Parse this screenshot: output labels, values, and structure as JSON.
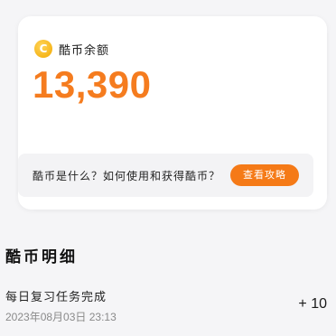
{
  "balance": {
    "icon": "coin-icon",
    "icon_glyph": "C",
    "label": "酷币余额",
    "amount": "13,390",
    "accent_color": "#f57c1f"
  },
  "help": {
    "question": "酷币是什么？如何使用和获得酷币？",
    "button_label": "查看攻略",
    "button_color": "#f57a17"
  },
  "details": {
    "title": "酷币明细",
    "items": [
      {
        "title": "每日复习任务完成",
        "time": "2023年08月03日 23:13",
        "value": "+ 10"
      }
    ]
  }
}
